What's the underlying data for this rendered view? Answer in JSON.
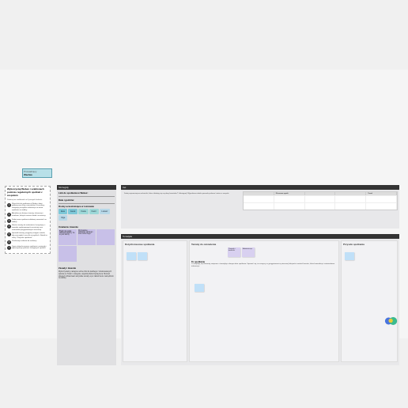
{
  "badge": {
    "label": "Prowadzący",
    "name": "Wacław"
  },
  "guide": {
    "title": "Wykorzystaj Webex i szablonach podczas regularnych spotkań z zespołem",
    "sub": "Podaruj ten szablonach w 6 prostych krokach:",
    "steps": [
      "Wpisz link do spotkania w Webex, datę i godzinę oraz listę uczestników. Uczestnicy otrzymają wszystkie informacje na temat spotkania na tablicy.",
      "Aktualizuj na bieżąco tematy, informacje i ustalenia, których możesz dodać uczestnicy.",
      "Dodaj nowe spotkania dodawaj zawartość na tablicę.",
      "Skończ tematy do omówienia, korzystając z tematów zaplanowanych wcześniej oraz materiałów przygotowanych wcześniej.",
      "Sprawdź tematy, przygotuj wstępne notatki, aby oszczędzić czas dla wszystkich. Notatki w sekcji \"Przyszłe spotkania\".",
      "Przekazuje zadania do realizacji.",
      "Zapisz dotychczasowe spotkania i materiały i wykorzystaj je podczas następnych spotkań."
    ]
  },
  "leftPanel": {
    "header": "Szczegóły",
    "link": "Link do spotkania w Webex:",
    "datetime": "Data i godzina:",
    "participants": "Osoby uczestniczące w rozmowie",
    "chips": [
      "Ewa",
      "Jacek",
      "Kasia",
      "Karol",
      "Łukasz",
      "Olga"
    ],
    "actionsTitle": "Ustalenia i kwestie",
    "cards": [
      {
        "t": "Typ1 na czas",
        "d": "Odpowiedzialny za to jest każdy"
      },
      {
        "t": "",
        "d": "Wymagane działanie każdego dnia roboczego"
      },
      {
        "t": "",
        "d": ""
      },
      {
        "t": "",
        "d": ""
      }
    ],
    "rulesTitle": "Zasady i kwestie",
    "rulesText": "Wykorzystamy następne wolne linki do każdego z dostosowanych opisów po Twoim i wstępnie uzgodnij Wykorzystaj Aura. Możesz również zobrazować wszystkie tematy a po zakończeniu narzędziom na tablicy."
  },
  "topPanel": {
    "header": "Cel",
    "note": "Dodaj najważniejsze wskaźniki, które składają się na plany kwartalne? Udostępnij! Wypełniona tabela pozwala pokazać status w zespole.",
    "th": [
      "",
      "Kluczowe wyniki",
      "",
      "",
      "Trend"
    ]
  },
  "mainPanel": {
    "header": "Tematyka",
    "col1": {
      "title": "Dotychczasowe spotkania"
    },
    "col2": {
      "title": "Tematy do omówienia",
      "stickies": [
        "",
        "Pomysły i działania",
        "Administracja"
      ],
      "sub": "To spotkanie",
      "subnote": "Tu znajdują się elementy związane z tematyką w danym dniu spotkania. Upewnić się, że wszyscy są przygotowani w pierwszej kolejności omówić kwestie, które komunikuje i zatwierdzone informacje."
    },
    "col3": {
      "title": "Przyszłe spotkania"
    }
  }
}
